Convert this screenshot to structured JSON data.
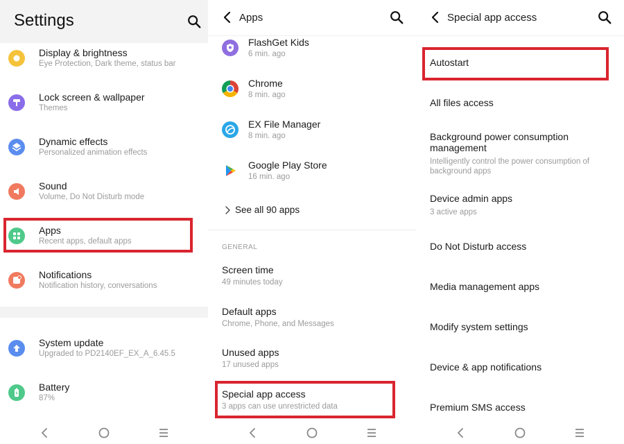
{
  "colors": {
    "highlight": "#d9252f",
    "background": "#ffffff",
    "settings_bg": "#f3f3f3"
  },
  "settings": {
    "title": "Settings",
    "items": [
      {
        "title": "Display & brightness",
        "subtitle": "Eye Protection, Dark theme, status bar",
        "icon": "sun-icon",
        "color": "#f5c33b"
      },
      {
        "title": "Lock screen & wallpaper",
        "subtitle": "Themes",
        "icon": "paint-roller-icon",
        "color": "#8a6de9"
      },
      {
        "title": "Dynamic effects",
        "subtitle": "Personalized animation effects",
        "icon": "layers-icon",
        "color": "#5b8def"
      },
      {
        "title": "Sound",
        "subtitle": "Volume, Do Not Disturb mode",
        "icon": "speaker-icon",
        "color": "#f07a5f"
      },
      {
        "title": "Apps",
        "subtitle": "Recent apps, default apps",
        "icon": "apps-grid-icon",
        "color": "#4fc98a"
      },
      {
        "title": "Notifications",
        "subtitle": "Notification history, conversations",
        "icon": "bell-icon",
        "color": "#f07a5f"
      }
    ],
    "items2": [
      {
        "title": "System update",
        "subtitle": "Upgraded to PD2140EF_EX_A_6.45.5",
        "icon": "update-arrow-icon",
        "color": "#5b8def"
      },
      {
        "title": "Battery",
        "subtitle": "87%",
        "icon": "battery-icon",
        "color": "#4fc98a"
      }
    ]
  },
  "apps": {
    "title": "Apps",
    "recent": [
      {
        "name": "FlashGet Kids",
        "time": "6 min. ago",
        "icon": "flashget-kids-icon"
      },
      {
        "name": "Chrome",
        "time": "8 min. ago",
        "icon": "chrome-icon"
      },
      {
        "name": "EX File Manager",
        "time": "8 min. ago",
        "icon": "ex-file-manager-icon"
      },
      {
        "name": "Google Play Store",
        "time": "16 min. ago",
        "icon": "play-store-icon"
      }
    ],
    "see_all": "See all 90 apps",
    "section": "GENERAL",
    "general": [
      {
        "title": "Screen time",
        "subtitle": "49 minutes today"
      },
      {
        "title": "Default apps",
        "subtitle": "Chrome, Phone, and Messages"
      },
      {
        "title": "Unused apps",
        "subtitle": "17 unused apps"
      },
      {
        "title": "Special app access",
        "subtitle": "3 apps can use unrestricted data"
      }
    ]
  },
  "special_access": {
    "title": "Special app access",
    "items": [
      {
        "title": "Autostart",
        "subtitle": ""
      },
      {
        "title": "All files access",
        "subtitle": ""
      },
      {
        "title": "Background power consumption management",
        "subtitle": "Intelligently control the power consumption of background apps"
      },
      {
        "title": "Device admin apps",
        "subtitle": "3 active apps"
      },
      {
        "title": "Do Not Disturb access",
        "subtitle": ""
      },
      {
        "title": "Media management apps",
        "subtitle": ""
      },
      {
        "title": "Modify system settings",
        "subtitle": ""
      },
      {
        "title": "Device & app notifications",
        "subtitle": ""
      },
      {
        "title": "Premium SMS access",
        "subtitle": ""
      }
    ]
  }
}
